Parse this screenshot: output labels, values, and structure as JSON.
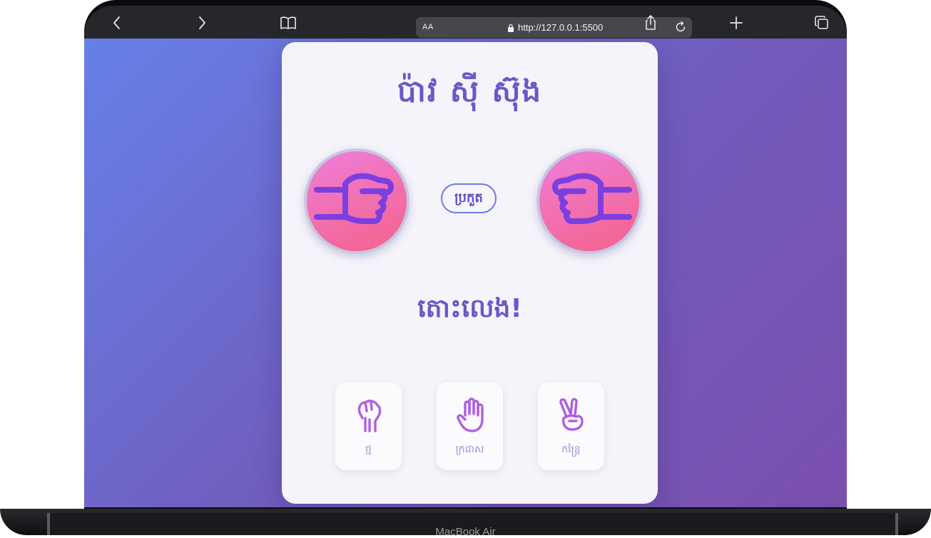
{
  "browser": {
    "reader_label": "AA",
    "url": "http://127.0.0.1:5500",
    "icons": [
      "chevron-left-icon",
      "chevron-right-icon",
      "book-icon",
      "lock-icon",
      "reload-icon",
      "share-icon",
      "plus-icon",
      "tabs-icon"
    ]
  },
  "game": {
    "title": "ប៉ាវ ស៊ី ស៊ុង",
    "vs_label": "ប្រកួត",
    "status_text": "តោះលេង!",
    "player_hand_icon": "pointing-hand-icon",
    "computer_hand_icon": "pointing-hand-icon",
    "choices": [
      {
        "label": "ថ្ម",
        "icon": "fist-icon"
      },
      {
        "label": "ក្រដាស",
        "icon": "open-hand-icon"
      },
      {
        "label": "កន្ត្រៃ",
        "icon": "peace-hand-icon"
      }
    ]
  },
  "device": {
    "model_label": "MacBook Air"
  },
  "colors": {
    "accent": "#6a58c8",
    "hand_stroke": "#7b3fe0",
    "choice_icon": "#b15ee0",
    "choice_label": "#a68ad8"
  }
}
